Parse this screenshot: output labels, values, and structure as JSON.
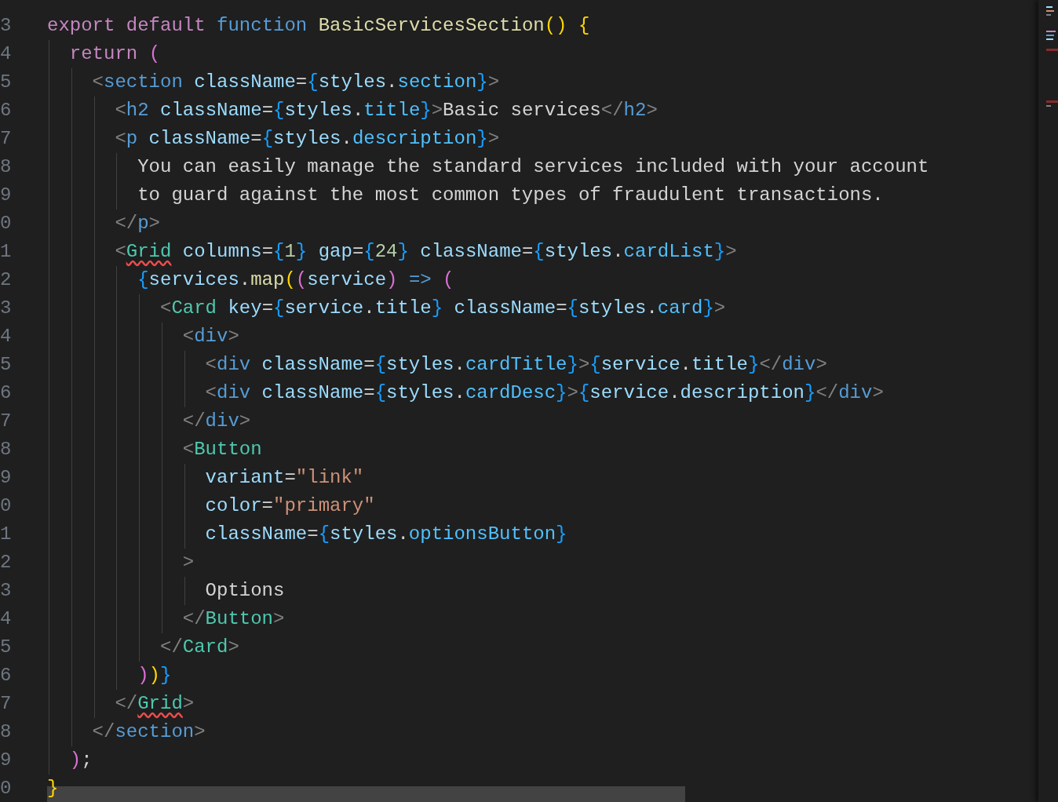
{
  "editor": {
    "lines": [
      {
        "number": "3",
        "tokens": [
          {
            "kind": "kw",
            "text": "export default "
          },
          {
            "kind": "fn",
            "text": "function "
          },
          {
            "kind": "name",
            "text": "BasicServicesSection"
          },
          {
            "kind": "b1",
            "text": "() {"
          }
        ]
      },
      {
        "number": "4",
        "tokens": [
          {
            "kind": "kw",
            "text": "  return "
          },
          {
            "kind": "b2",
            "text": "("
          }
        ]
      },
      {
        "number": "5",
        "tokens": [
          {
            "kind": "punct",
            "text": "    <"
          },
          {
            "kind": "tag",
            "text": "section "
          },
          {
            "kind": "attr",
            "text": "className"
          },
          {
            "kind": "op",
            "text": "="
          },
          {
            "kind": "b3",
            "text": "{"
          },
          {
            "kind": "var",
            "text": "styles"
          },
          {
            "kind": "op",
            "text": "."
          },
          {
            "kind": "prop",
            "text": "section"
          },
          {
            "kind": "b3",
            "text": "}"
          },
          {
            "kind": "punct",
            "text": ">"
          }
        ]
      },
      {
        "number": "6",
        "tokens": [
          {
            "kind": "punct",
            "text": "      <"
          },
          {
            "kind": "tag",
            "text": "h2 "
          },
          {
            "kind": "attr",
            "text": "className"
          },
          {
            "kind": "op",
            "text": "="
          },
          {
            "kind": "b3",
            "text": "{"
          },
          {
            "kind": "var",
            "text": "styles"
          },
          {
            "kind": "op",
            "text": "."
          },
          {
            "kind": "prop",
            "text": "title"
          },
          {
            "kind": "b3",
            "text": "}"
          },
          {
            "kind": "punct",
            "text": ">"
          },
          {
            "kind": "op",
            "text": "Basic services"
          },
          {
            "kind": "punct",
            "text": "</"
          },
          {
            "kind": "tag",
            "text": "h2"
          },
          {
            "kind": "punct",
            "text": ">"
          }
        ]
      },
      {
        "number": "7",
        "tokens": [
          {
            "kind": "punct",
            "text": "      <"
          },
          {
            "kind": "tag",
            "text": "p "
          },
          {
            "kind": "attr",
            "text": "className"
          },
          {
            "kind": "op",
            "text": "="
          },
          {
            "kind": "b3",
            "text": "{"
          },
          {
            "kind": "var",
            "text": "styles"
          },
          {
            "kind": "op",
            "text": "."
          },
          {
            "kind": "prop",
            "text": "description"
          },
          {
            "kind": "b3",
            "text": "}"
          },
          {
            "kind": "punct",
            "text": ">"
          }
        ]
      },
      {
        "number": "8",
        "tokens": [
          {
            "kind": "op",
            "text": "        You can easily manage the standard services included with your account"
          }
        ]
      },
      {
        "number": "9",
        "tokens": [
          {
            "kind": "op",
            "text": "        to guard against the most common types of fraudulent transactions."
          }
        ]
      },
      {
        "number": "0",
        "tokens": [
          {
            "kind": "punct",
            "text": "      </"
          },
          {
            "kind": "tag",
            "text": "p"
          },
          {
            "kind": "punct",
            "text": ">"
          }
        ]
      },
      {
        "number": "1",
        "tokens": [
          {
            "kind": "punct",
            "text": "      <"
          },
          {
            "kind": "comp",
            "text": "Grid",
            "error": true
          },
          {
            "kind": "attr",
            "text": " columns"
          },
          {
            "kind": "op",
            "text": "="
          },
          {
            "kind": "b3",
            "text": "{"
          },
          {
            "kind": "num",
            "text": "1"
          },
          {
            "kind": "b3",
            "text": "} "
          },
          {
            "kind": "attr",
            "text": "gap"
          },
          {
            "kind": "op",
            "text": "="
          },
          {
            "kind": "b3",
            "text": "{"
          },
          {
            "kind": "num",
            "text": "24"
          },
          {
            "kind": "b3",
            "text": "} "
          },
          {
            "kind": "attr",
            "text": "className"
          },
          {
            "kind": "op",
            "text": "="
          },
          {
            "kind": "b3",
            "text": "{"
          },
          {
            "kind": "var",
            "text": "styles"
          },
          {
            "kind": "op",
            "text": "."
          },
          {
            "kind": "prop",
            "text": "cardList"
          },
          {
            "kind": "b3",
            "text": "}"
          },
          {
            "kind": "punct",
            "text": ">"
          }
        ]
      },
      {
        "number": "2",
        "tokens": [
          {
            "kind": "b3",
            "text": "        {"
          },
          {
            "kind": "var",
            "text": "services"
          },
          {
            "kind": "op",
            "text": "."
          },
          {
            "kind": "name",
            "text": "map"
          },
          {
            "kind": "b1",
            "text": "("
          },
          {
            "kind": "b2",
            "text": "("
          },
          {
            "kind": "var",
            "text": "service"
          },
          {
            "kind": "b2",
            "text": ")"
          },
          {
            "kind": "fn",
            "text": " => "
          },
          {
            "kind": "b2",
            "text": "("
          }
        ]
      },
      {
        "number": "3",
        "tokens": [
          {
            "kind": "punct",
            "text": "          <"
          },
          {
            "kind": "comp",
            "text": "Card "
          },
          {
            "kind": "attr",
            "text": "key"
          },
          {
            "kind": "op",
            "text": "="
          },
          {
            "kind": "b3",
            "text": "{"
          },
          {
            "kind": "var",
            "text": "service"
          },
          {
            "kind": "op",
            "text": "."
          },
          {
            "kind": "var",
            "text": "title"
          },
          {
            "kind": "b3",
            "text": "} "
          },
          {
            "kind": "attr",
            "text": "className"
          },
          {
            "kind": "op",
            "text": "="
          },
          {
            "kind": "b3",
            "text": "{"
          },
          {
            "kind": "var",
            "text": "styles"
          },
          {
            "kind": "op",
            "text": "."
          },
          {
            "kind": "prop",
            "text": "card"
          },
          {
            "kind": "b3",
            "text": "}"
          },
          {
            "kind": "punct",
            "text": ">"
          }
        ]
      },
      {
        "number": "4",
        "tokens": [
          {
            "kind": "punct",
            "text": "            <"
          },
          {
            "kind": "tag",
            "text": "div"
          },
          {
            "kind": "punct",
            "text": ">"
          }
        ]
      },
      {
        "number": "5",
        "tokens": [
          {
            "kind": "punct",
            "text": "              <"
          },
          {
            "kind": "tag",
            "text": "div "
          },
          {
            "kind": "attr",
            "text": "className"
          },
          {
            "kind": "op",
            "text": "="
          },
          {
            "kind": "b3",
            "text": "{"
          },
          {
            "kind": "var",
            "text": "styles"
          },
          {
            "kind": "op",
            "text": "."
          },
          {
            "kind": "prop",
            "text": "cardTitle"
          },
          {
            "kind": "b3",
            "text": "}"
          },
          {
            "kind": "punct",
            "text": ">"
          },
          {
            "kind": "b3",
            "text": "{"
          },
          {
            "kind": "var",
            "text": "service"
          },
          {
            "kind": "op",
            "text": "."
          },
          {
            "kind": "var",
            "text": "title"
          },
          {
            "kind": "b3",
            "text": "}"
          },
          {
            "kind": "punct",
            "text": "</"
          },
          {
            "kind": "tag",
            "text": "div"
          },
          {
            "kind": "punct",
            "text": ">"
          }
        ]
      },
      {
        "number": "6",
        "tokens": [
          {
            "kind": "punct",
            "text": "              <"
          },
          {
            "kind": "tag",
            "text": "div "
          },
          {
            "kind": "attr",
            "text": "className"
          },
          {
            "kind": "op",
            "text": "="
          },
          {
            "kind": "b3",
            "text": "{"
          },
          {
            "kind": "var",
            "text": "styles"
          },
          {
            "kind": "op",
            "text": "."
          },
          {
            "kind": "prop",
            "text": "cardDesc"
          },
          {
            "kind": "b3",
            "text": "}"
          },
          {
            "kind": "punct",
            "text": ">"
          },
          {
            "kind": "b3",
            "text": "{"
          },
          {
            "kind": "var",
            "text": "service"
          },
          {
            "kind": "op",
            "text": "."
          },
          {
            "kind": "var",
            "text": "description"
          },
          {
            "kind": "b3",
            "text": "}"
          },
          {
            "kind": "punct",
            "text": "</"
          },
          {
            "kind": "tag",
            "text": "div"
          },
          {
            "kind": "punct",
            "text": ">"
          }
        ]
      },
      {
        "number": "7",
        "tokens": [
          {
            "kind": "punct",
            "text": "            </"
          },
          {
            "kind": "tag",
            "text": "div"
          },
          {
            "kind": "punct",
            "text": ">"
          }
        ]
      },
      {
        "number": "8",
        "tokens": [
          {
            "kind": "punct",
            "text": "            <"
          },
          {
            "kind": "comp",
            "text": "Button"
          }
        ]
      },
      {
        "number": "9",
        "tokens": [
          {
            "kind": "attr",
            "text": "              variant"
          },
          {
            "kind": "op",
            "text": "="
          },
          {
            "kind": "str",
            "text": "\"link\""
          }
        ]
      },
      {
        "number": "0",
        "tokens": [
          {
            "kind": "attr",
            "text": "              color"
          },
          {
            "kind": "op",
            "text": "="
          },
          {
            "kind": "str",
            "text": "\"primary\""
          }
        ]
      },
      {
        "number": "1",
        "tokens": [
          {
            "kind": "attr",
            "text": "              className"
          },
          {
            "kind": "op",
            "text": "="
          },
          {
            "kind": "b3",
            "text": "{"
          },
          {
            "kind": "var",
            "text": "styles"
          },
          {
            "kind": "op",
            "text": "."
          },
          {
            "kind": "prop",
            "text": "optionsButton"
          },
          {
            "kind": "b3",
            "text": "}"
          }
        ]
      },
      {
        "number": "2",
        "tokens": [
          {
            "kind": "punct",
            "text": "            >"
          }
        ]
      },
      {
        "number": "3",
        "tokens": [
          {
            "kind": "op",
            "text": "              Options"
          }
        ]
      },
      {
        "number": "4",
        "tokens": [
          {
            "kind": "punct",
            "text": "            </"
          },
          {
            "kind": "comp",
            "text": "Button"
          },
          {
            "kind": "punct",
            "text": ">"
          }
        ]
      },
      {
        "number": "5",
        "tokens": [
          {
            "kind": "punct",
            "text": "          </"
          },
          {
            "kind": "comp",
            "text": "Card"
          },
          {
            "kind": "punct",
            "text": ">"
          }
        ]
      },
      {
        "number": "6",
        "tokens": [
          {
            "kind": "b2",
            "text": "        )"
          },
          {
            "kind": "b1",
            "text": ")"
          },
          {
            "kind": "b3",
            "text": "}"
          }
        ]
      },
      {
        "number": "7",
        "tokens": [
          {
            "kind": "punct",
            "text": "      </"
          },
          {
            "kind": "comp",
            "text": "Grid",
            "error": true
          },
          {
            "kind": "punct",
            "text": ">"
          }
        ]
      },
      {
        "number": "8",
        "tokens": [
          {
            "kind": "punct",
            "text": "    </"
          },
          {
            "kind": "tag",
            "text": "section"
          },
          {
            "kind": "punct",
            "text": ">"
          }
        ]
      },
      {
        "number": "9",
        "tokens": [
          {
            "kind": "b2",
            "text": "  )"
          },
          {
            "kind": "op",
            "text": ";"
          }
        ]
      },
      {
        "number": "0",
        "tokens": [
          {
            "kind": "b1",
            "text": "}"
          }
        ]
      }
    ]
  }
}
